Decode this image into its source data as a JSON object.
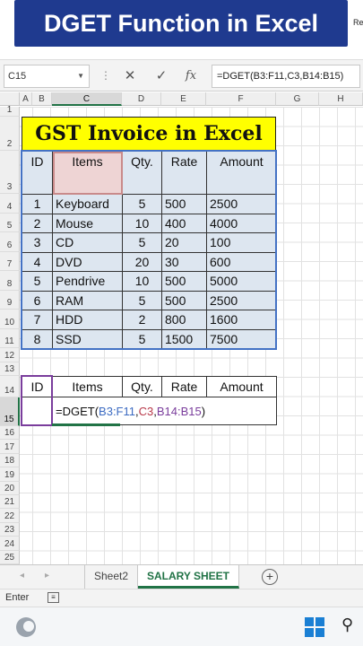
{
  "banner": {
    "title": "DGET Function in Excel",
    "edge_text": "Re"
  },
  "formula_bar": {
    "name_box": "C15",
    "formula": "=DGET(B3:F11,C3,B14:B15)",
    "cancel_icon": "x-icon",
    "enter_icon": "check-icon",
    "fx_label": "fx"
  },
  "columns": [
    "A",
    "B",
    "C",
    "D",
    "E",
    "F",
    "G",
    "H"
  ],
  "rows": [
    "1",
    "2",
    "3",
    "4",
    "5",
    "6",
    "7",
    "8",
    "9",
    "10",
    "11",
    "12",
    "13",
    "14",
    "15",
    "16",
    "17",
    "18",
    "19",
    "20",
    "21",
    "22",
    "23",
    "24",
    "25"
  ],
  "invoice_title": "GST Invoice in Excel",
  "table1": {
    "headers": [
      "ID",
      "Items",
      "Qty.",
      "Rate",
      "Amount"
    ],
    "rows": [
      [
        "1",
        "Keyboard",
        "5",
        "500",
        "2500"
      ],
      [
        "2",
        "Mouse",
        "10",
        "400",
        "4000"
      ],
      [
        "3",
        "CD",
        "5",
        "20",
        "100"
      ],
      [
        "4",
        "DVD",
        "20",
        "30",
        "600"
      ],
      [
        "5",
        "Pendrive",
        "10",
        "500",
        "5000"
      ],
      [
        "6",
        "RAM",
        "5",
        "500",
        "2500"
      ],
      [
        "7",
        "HDD",
        "2",
        "800",
        "1600"
      ],
      [
        "8",
        "SSD",
        "5",
        "1500",
        "7500"
      ]
    ]
  },
  "table2": {
    "headers": [
      "ID",
      "Items",
      "Qty.",
      "Rate",
      "Amount"
    ],
    "formula_parts": {
      "prefix": "=DGET(",
      "range": "B3:F11",
      "comma1": ",",
      "field": "C3",
      "comma2": ",",
      "criteria": "B14:B15",
      "suffix": ")"
    }
  },
  "sheet_tabs": {
    "tabs": [
      "Sheet2",
      "SALARY SHEET"
    ],
    "active": "SALARY SHEET",
    "add_icon": "plus-icon"
  },
  "status": {
    "mode": "Enter"
  },
  "taskbar": {
    "start_icon": "windows-icon",
    "search_icon": "search-icon",
    "weather_icon": "weather-icon"
  }
}
